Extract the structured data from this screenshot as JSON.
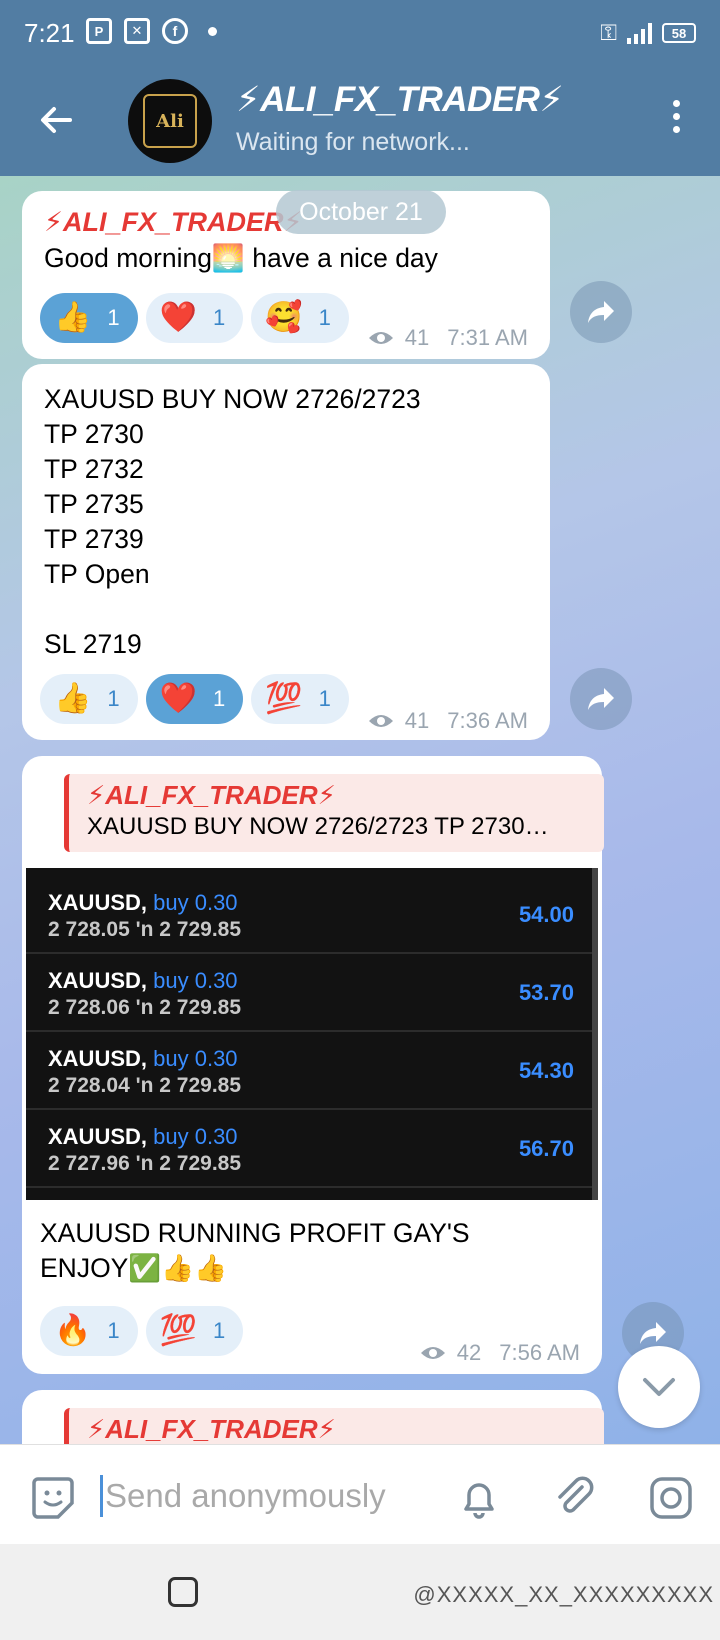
{
  "status_bar": {
    "time": "7:21",
    "battery": "58"
  },
  "header": {
    "title": "⚡ALI_FX_TRADER⚡",
    "subtitle": "Waiting for network...",
    "avatar_text": "Ali"
  },
  "date_pill": "October 21",
  "messages": [
    {
      "sender": "⚡ALI_FX_TRADER⚡",
      "text": "Good morning🌅 have a nice day",
      "reactions": [
        {
          "emoji": "👍",
          "count": "1",
          "active": true
        },
        {
          "emoji": "❤️",
          "count": "1",
          "active": false
        },
        {
          "emoji": "🥰",
          "count": "1",
          "active": false
        }
      ],
      "views": "41",
      "time": "7:31 AM"
    },
    {
      "text": "XAUUSD BUY NOW 2726/2723\nTP 2730\nTP 2732\nTP 2735\nTP 2739\nTP Open\n\nSL 2719",
      "reactions": [
        {
          "emoji": "👍",
          "count": "1",
          "active": false
        },
        {
          "emoji": "❤️",
          "count": "1",
          "active": true
        },
        {
          "emoji": "💯",
          "count": "1",
          "active": false
        }
      ],
      "views": "41",
      "time": "7:36 AM"
    },
    {
      "reply": {
        "title": "⚡ALI_FX_TRADER⚡",
        "text": "XAUUSD BUY NOW 2726/2723 TP 2730…"
      },
      "trades": [
        {
          "symbol": "XAUUSD,",
          "dir": "buy 0.30",
          "from": "2 728.05",
          "to": "2 729.85",
          "profit": "54.00"
        },
        {
          "symbol": "XAUUSD,",
          "dir": "buy 0.30",
          "from": "2 728.06",
          "to": "2 729.85",
          "profit": "53.70"
        },
        {
          "symbol": "XAUUSD,",
          "dir": "buy 0.30",
          "from": "2 728.04",
          "to": "2 729.85",
          "profit": "54.30"
        },
        {
          "symbol": "XAUUSD,",
          "dir": "buy 0.30",
          "from": "2 727.96",
          "to": "2 729.85",
          "profit": "56.70"
        }
      ],
      "arrow": "'n",
      "text": "XAUUSD RUNNING PROFIT GAY'S\nENJOY✅👍👍",
      "reactions": [
        {
          "emoji": "🔥",
          "count": "1",
          "active": false
        },
        {
          "emoji": "💯",
          "count": "1",
          "active": false
        }
      ],
      "views": "42",
      "time": "7:56 AM"
    },
    {
      "reply_title": "⚡ALI_FX_TRADER⚡"
    }
  ],
  "input": {
    "placeholder": "Send anonymously"
  },
  "watermark": "@XXXXX_XX_XXXXXXXXX",
  "colors": {
    "header": "#527da3",
    "sender": "#e53935",
    "reaction_active": "#5ba2d6",
    "profit": "#3a8dff"
  }
}
